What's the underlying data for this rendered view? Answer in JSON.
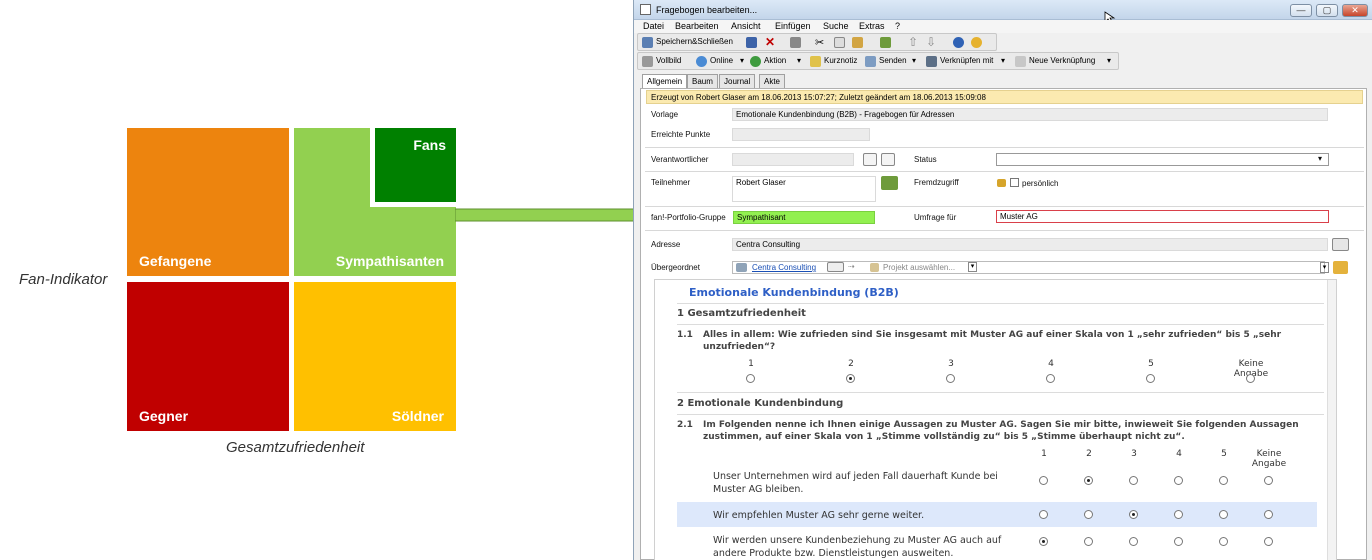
{
  "matrix": {
    "quadrants": {
      "gefangene": {
        "label": "Gefangene",
        "color": "#ed840e"
      },
      "sympathisanten": {
        "label": "Sympathisanten",
        "color": "#92d050"
      },
      "fans": {
        "label": "Fans",
        "color": "#008000"
      },
      "gegner": {
        "label": "Gegner",
        "color": "#c00000"
      },
      "soeldner": {
        "label": "Söldner",
        "color": "#ffc000"
      }
    },
    "y_axis": "Fan-Indikator",
    "x_axis": "Gesamtzufriedenheit"
  },
  "window": {
    "title": "Fragebogen bearbeiten...",
    "menu": [
      "Datei",
      "Bearbeiten",
      "Ansicht",
      "Einfügen",
      "Suche",
      "Extras",
      "?"
    ],
    "toolbar1": {
      "save_close": "Speichern&Schließen"
    },
    "toolbar2": {
      "vollbild": "Vollbild",
      "online": "Online",
      "aktion": "Aktion",
      "kurznotiz": "Kurznotiz",
      "senden": "Senden",
      "verknuepfen": "Verknüpfen mit",
      "neue_verknuepfung": "Neue Verknüpfung"
    },
    "tabs": [
      "Allgemein",
      "Baum",
      "Journal",
      "Akte"
    ],
    "banner": "Erzeugt von Robert Glaser am 18.06.2013 15:07:27; Zuletzt geändert am 18.06.2013 15:09:08",
    "form": {
      "vorlage_label": "Vorlage",
      "vorlage_value": "Emotionale Kundenbindung (B2B) - Fragebogen für Adressen",
      "punkte_label": "Erreichte Punkte",
      "punkte_value": "",
      "verantwortlicher_label": "Verantwortlicher",
      "status_label": "Status",
      "teilnehmer_label": "Teilnehmer",
      "teilnehmer_value": "Robert Glaser",
      "fremdzugriff_label": "Fremdzugriff",
      "persoenlich_label": "persönlich",
      "portfolio_label": "fan!-Portfolio-Gruppe",
      "portfolio_value": "Sympathisant",
      "umfrage_label": "Umfrage für",
      "umfrage_value": "Muster AG",
      "adresse_label": "Adresse",
      "adresse_value": "Centra Consulting",
      "uebergeordnet_label": "Übergeordnet",
      "uebergeordnet_value": "Centra Consulting",
      "projekt_placeholder": "Projekt auswählen..."
    }
  },
  "survey": {
    "title": "Emotionale Kundenbindung (B2B)",
    "section1": "1  Gesamtzufriedenheit",
    "q1_num": "1.1",
    "q1_text": "Alles in allem: Wie zufrieden sind Sie insgesamt mit Muster AG auf einer Skala von 1 „sehr zufrieden“ bis 5 „sehr unzufrieden“?",
    "q1_scale": [
      "1",
      "2",
      "3",
      "4",
      "5",
      "Keine Angabe"
    ],
    "q1_selected": 2,
    "section2": "2  Emotionale Kundenbindung",
    "q2_num": "2.1",
    "q2_text": "Im Folgenden nenne ich Ihnen einige Aussagen zu Muster AG. Sagen Sie mir bitte, inwieweit Sie folgenden Aussagen zustimmen, auf einer Skala von 1 „Stimme vollständig zu“ bis 5 „Stimme überhaupt nicht zu“.",
    "q2_scale": [
      "1",
      "2",
      "3",
      "4",
      "5",
      "Keine Angabe"
    ],
    "statements": [
      {
        "text": "Unser Unternehmen wird auf jeden Fall dauerhaft Kunde bei Muster AG bleiben.",
        "selected": 2
      },
      {
        "text": "Wir empfehlen Muster AG sehr gerne weiter.",
        "selected": 3
      },
      {
        "text": "Wir werden unsere Kundenbeziehung zu Muster AG auch auf andere Produkte bzw. Dienstleistungen ausweiten.",
        "selected": 1
      }
    ]
  }
}
